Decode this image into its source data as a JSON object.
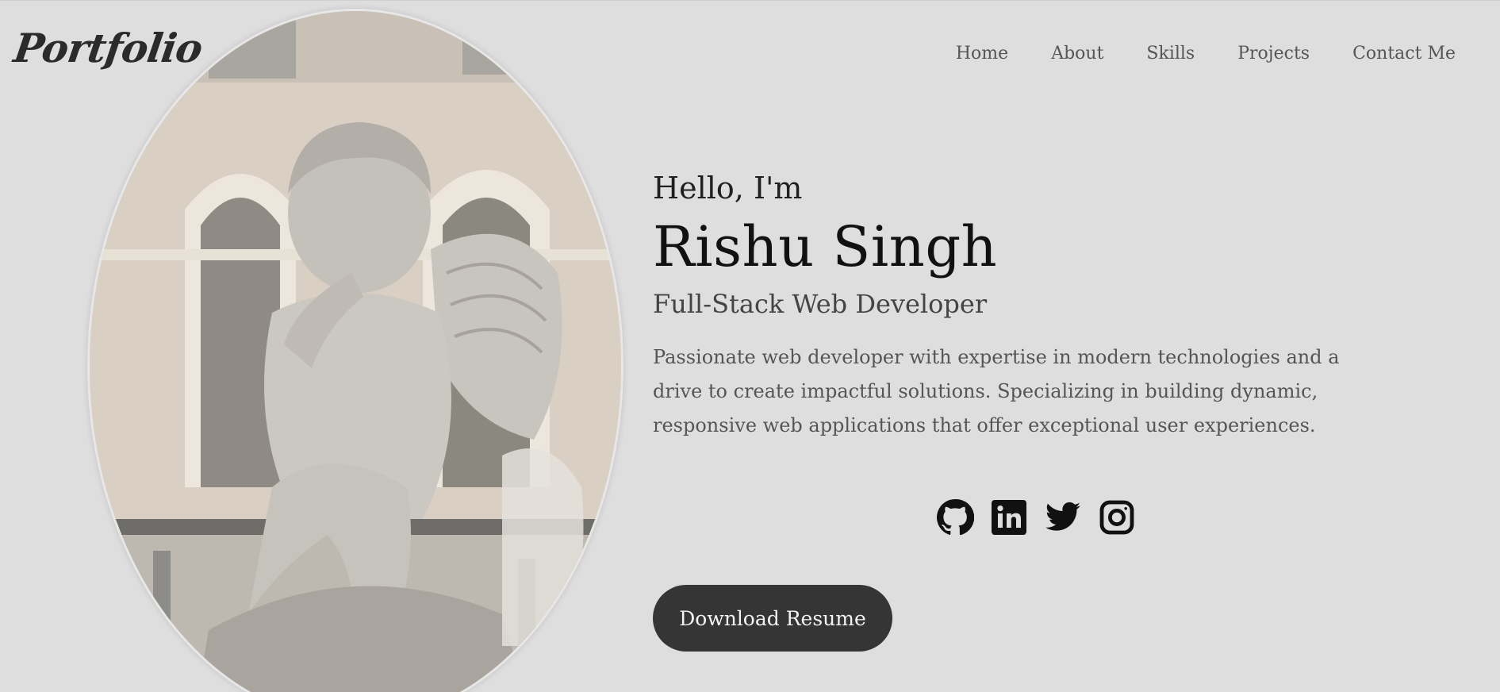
{
  "brand": {
    "logo_text": "Portfolio"
  },
  "nav": {
    "items": [
      {
        "label": "Home"
      },
      {
        "label": "About"
      },
      {
        "label": "Skills"
      },
      {
        "label": "Projects"
      },
      {
        "label": "Contact Me"
      }
    ]
  },
  "hero": {
    "greeting": "Hello, I'm",
    "name": "Rishu Singh",
    "role": "Full-Stack Web Developer",
    "bio": "Passionate web developer with expertise in modern technologies and a drive to create impactful solutions. Specializing in building dynamic, responsive web applications that offer exceptional user experiences.",
    "resume_button": "Download Resume"
  },
  "socials": [
    {
      "icon": "github-icon"
    },
    {
      "icon": "linkedin-icon"
    },
    {
      "icon": "twitter-icon"
    },
    {
      "icon": "instagram-icon"
    }
  ],
  "colors": {
    "background": "#dedede",
    "button": "#353535",
    "button_text": "#f3f3f3",
    "nav_text": "#555555"
  }
}
